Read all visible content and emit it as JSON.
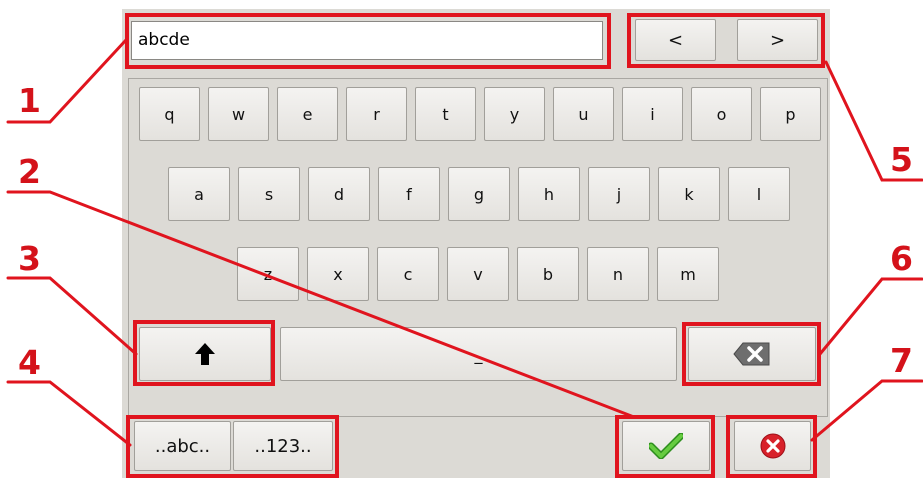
{
  "input": {
    "value": "abcde"
  },
  "nav": {
    "left_label": "<",
    "right_label": ">"
  },
  "keys": {
    "row1": [
      "q",
      "w",
      "e",
      "r",
      "t",
      "y",
      "u",
      "i",
      "o",
      "p"
    ],
    "row2": [
      "a",
      "s",
      "d",
      "f",
      "g",
      "h",
      "j",
      "k",
      "l"
    ],
    "row3": [
      "z",
      "x",
      "c",
      "v",
      "b",
      "n",
      "m"
    ]
  },
  "space": {
    "label": "_"
  },
  "shift": {
    "icon": "arrow-up-icon"
  },
  "backspace": {
    "icon": "backspace-icon"
  },
  "modes": {
    "abc_label": "..abc..",
    "num_label": "..123.."
  },
  "confirm": {
    "icon": "checkmark-icon",
    "color": "#3fae2a"
  },
  "cancel": {
    "icon": "close-circle-icon",
    "color": "#d8212a"
  },
  "callouts": [
    "1",
    "2",
    "3",
    "4",
    "5",
    "6",
    "7"
  ],
  "highlight_color": "#e0141e"
}
